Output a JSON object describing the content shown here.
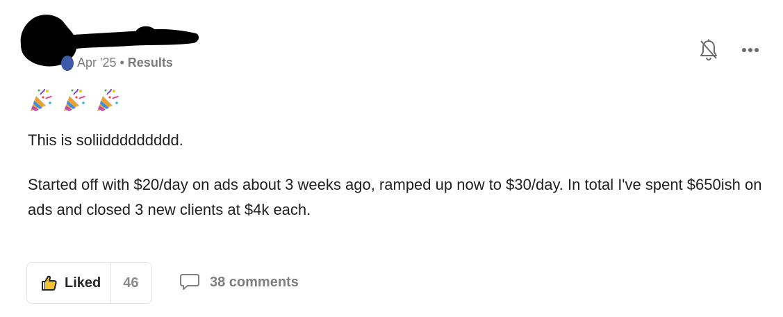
{
  "post": {
    "date": "Apr '25",
    "separator": "•",
    "category": "Results",
    "emojis": [
      "party-popper-icon",
      "party-popper-icon",
      "party-popper-icon"
    ],
    "line1": "This is soliiddddddddd.",
    "body": "Started off with $20/day on ads about 3 weeks ago, ramped up now to $30/day. In total I've spent $650ish on ads and closed 3 new clients at $4k each."
  },
  "actions": {
    "liked_label": "Liked",
    "like_count": "46",
    "comments_label": "38 comments"
  },
  "icons": {
    "bell": "bell-off-icon",
    "more": "more-horizontal-icon",
    "thumb": "thumbs-up-icon",
    "comment": "comment-bubble-icon"
  },
  "colors": {
    "redaction": "#000000",
    "avatar": "#3d5aa8",
    "muted_text": "#7b7b7b",
    "body_text": "#202020"
  }
}
